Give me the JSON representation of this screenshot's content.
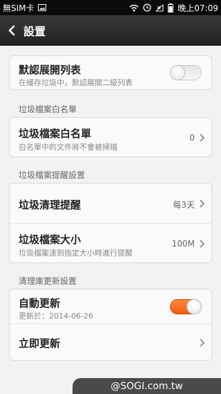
{
  "statusbar": {
    "carrier": "無SIM卡",
    "time": "晚上07:09"
  },
  "header": {
    "title": "設置"
  },
  "sections": {
    "expand": {
      "title": "默認展開列表",
      "subtitle": "在緩存垃圾中，默認展開二級列表",
      "toggle_state": "off"
    },
    "whitelist_label": "垃圾檔案白名單",
    "whitelist": {
      "title": "垃圾檔案白名單",
      "subtitle": "白名單中的文件將不會被掃描",
      "value": "0"
    },
    "reminder_label": "垃圾檔案提醒設置",
    "reminder": {
      "title": "垃圾清理提醒",
      "value": "每3天"
    },
    "size": {
      "title": "垃圾檔案大小",
      "subtitle": "垃圾檔案達到指定大小時進行提醒",
      "value": "100M"
    },
    "update_label": "清理庫更新設置",
    "auto_update": {
      "title": "自動更新",
      "subtitle": "更新於：2014-06-26",
      "toggle_state": "on"
    },
    "update_now": {
      "title": "立即更新"
    }
  },
  "watermark": "@SOGI.com.tw",
  "colors": {
    "accent": "#f26a1b",
    "titlebar": "#2b2b2b"
  }
}
